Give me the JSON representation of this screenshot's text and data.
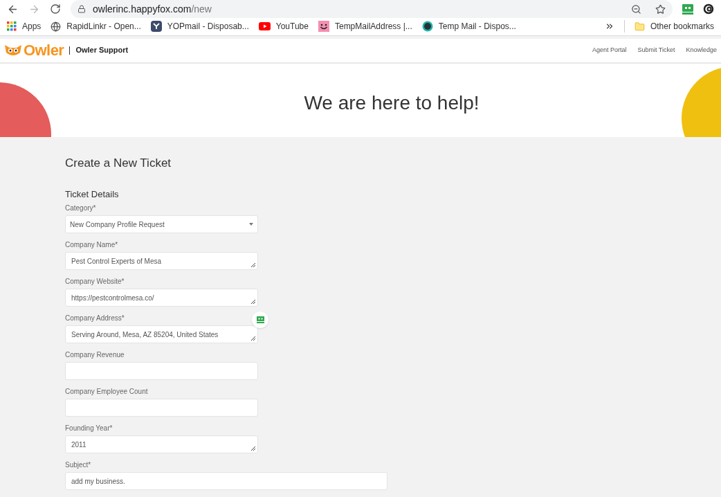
{
  "browser": {
    "url_host": "owlerinc.happyfox.com",
    "url_path": "/new"
  },
  "bookmarks": [
    {
      "label": "Apps"
    },
    {
      "label": "RapidLinkr - Open..."
    },
    {
      "label": "YOPmail - Disposab..."
    },
    {
      "label": "YouTube"
    },
    {
      "label": "TempMailAddress |..."
    },
    {
      "label": "Temp Mail - Dispos..."
    }
  ],
  "other_bookmarks": "Other bookmarks",
  "header": {
    "logo": "Owler",
    "title": "Owler Support",
    "nav": [
      "Agent Portal",
      "Submit Ticket",
      "Knowledge"
    ]
  },
  "hero": {
    "heading": "We are here to help!"
  },
  "form": {
    "title": "Create a New Ticket",
    "section": "Ticket Details",
    "fields": [
      {
        "label": "Category*",
        "kind": "select",
        "value": "New Company Profile Request"
      },
      {
        "label": "Company Name*",
        "kind": "textarea",
        "value": "Pest Control Experts of Mesa"
      },
      {
        "label": "Company Website*",
        "kind": "textarea",
        "value": "https://pestcontrolmesa.co/"
      },
      {
        "label": "Company Address*",
        "kind": "textarea",
        "value": "Serving Around, Mesa, AZ 85204, United States"
      },
      {
        "label": "Company Revenue",
        "kind": "input"
      },
      {
        "label": "Company Employee Count",
        "kind": "input"
      },
      {
        "label": "Founding Year*",
        "kind": "textarea",
        "value": "2011"
      },
      {
        "label": "Subject*",
        "kind": "wide",
        "value": "add my business."
      }
    ]
  }
}
